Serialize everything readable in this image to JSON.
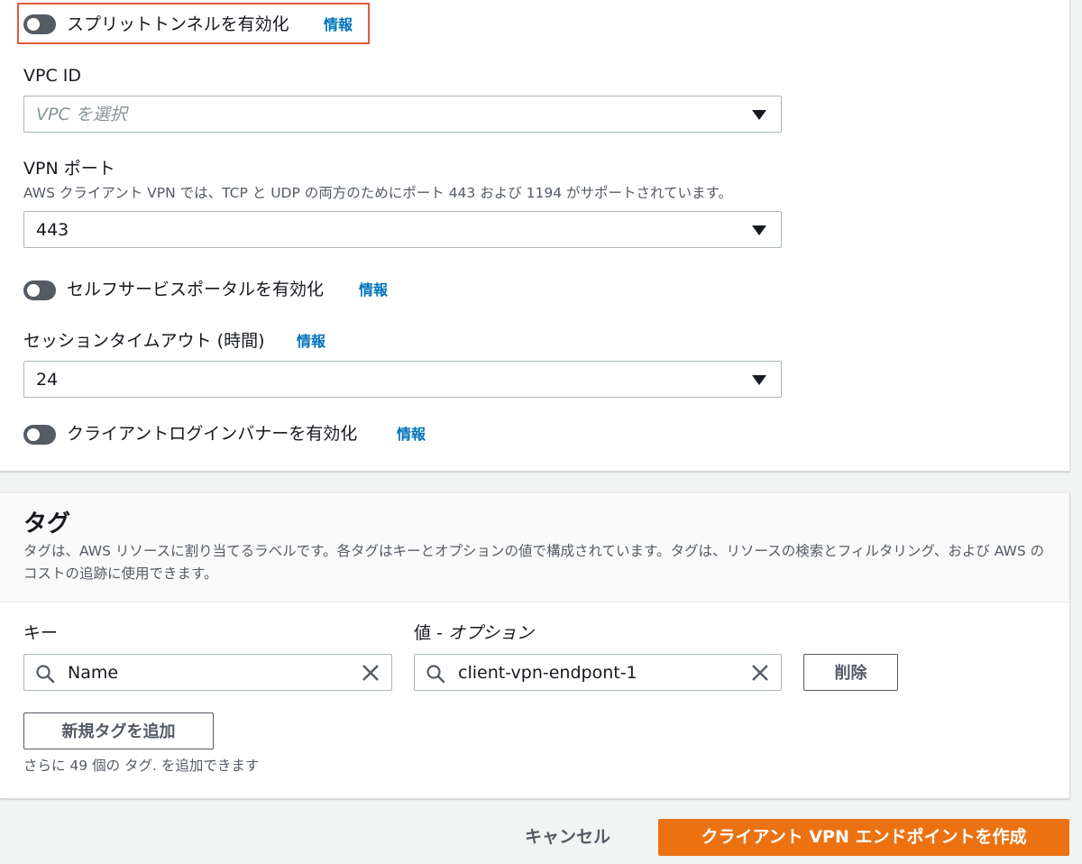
{
  "settings": {
    "split_tunnel": {
      "label": "スプリットトンネルを有効化",
      "info": "情報",
      "enabled": false
    },
    "vpc": {
      "label": "VPC ID",
      "placeholder": "VPC を選択"
    },
    "vpn_port": {
      "label": "VPN ポート",
      "description": "AWS クライアント VPN では、TCP と UDP の両方のためにポート 443 および 1194 がサポートされています。",
      "value": "443"
    },
    "self_service": {
      "label": "セルフサービスポータルを有効化",
      "info": "情報",
      "enabled": false
    },
    "session_timeout": {
      "label": "セッションタイムアウト (時間)",
      "info": "情報",
      "value": "24"
    },
    "login_banner": {
      "label": "クライアントログインバナーを有効化",
      "info": "情報",
      "enabled": false
    }
  },
  "tags": {
    "title": "タグ",
    "description": "タグは、AWS リソースに割り当てるラベルです。各タグはキーとオプションの値で構成されています。タグは、リソースの検索とフィルタリング、および AWS のコストの追跡に使用できます。",
    "key_label": "キー",
    "value_label_prefix": "値 - ",
    "value_label_suffix": "オプション",
    "rows": [
      {
        "key": "Name",
        "value": "client-vpn-endpont-1",
        "remove_label": "削除"
      }
    ],
    "add_label": "新規タグを追加",
    "hint": "さらに 49 個の タグ. を追加できます"
  },
  "footer": {
    "cancel_label": "キャンセル",
    "create_label": "クライアント VPN エンドポイントを作成"
  },
  "colors": {
    "primary": "#ec7211",
    "link": "#0073bb",
    "highlight": "#e25a3c",
    "toggle_off": "#545b64"
  },
  "icons": {
    "search": "search-icon",
    "clear": "close-icon",
    "caret": "caret-down-icon"
  }
}
